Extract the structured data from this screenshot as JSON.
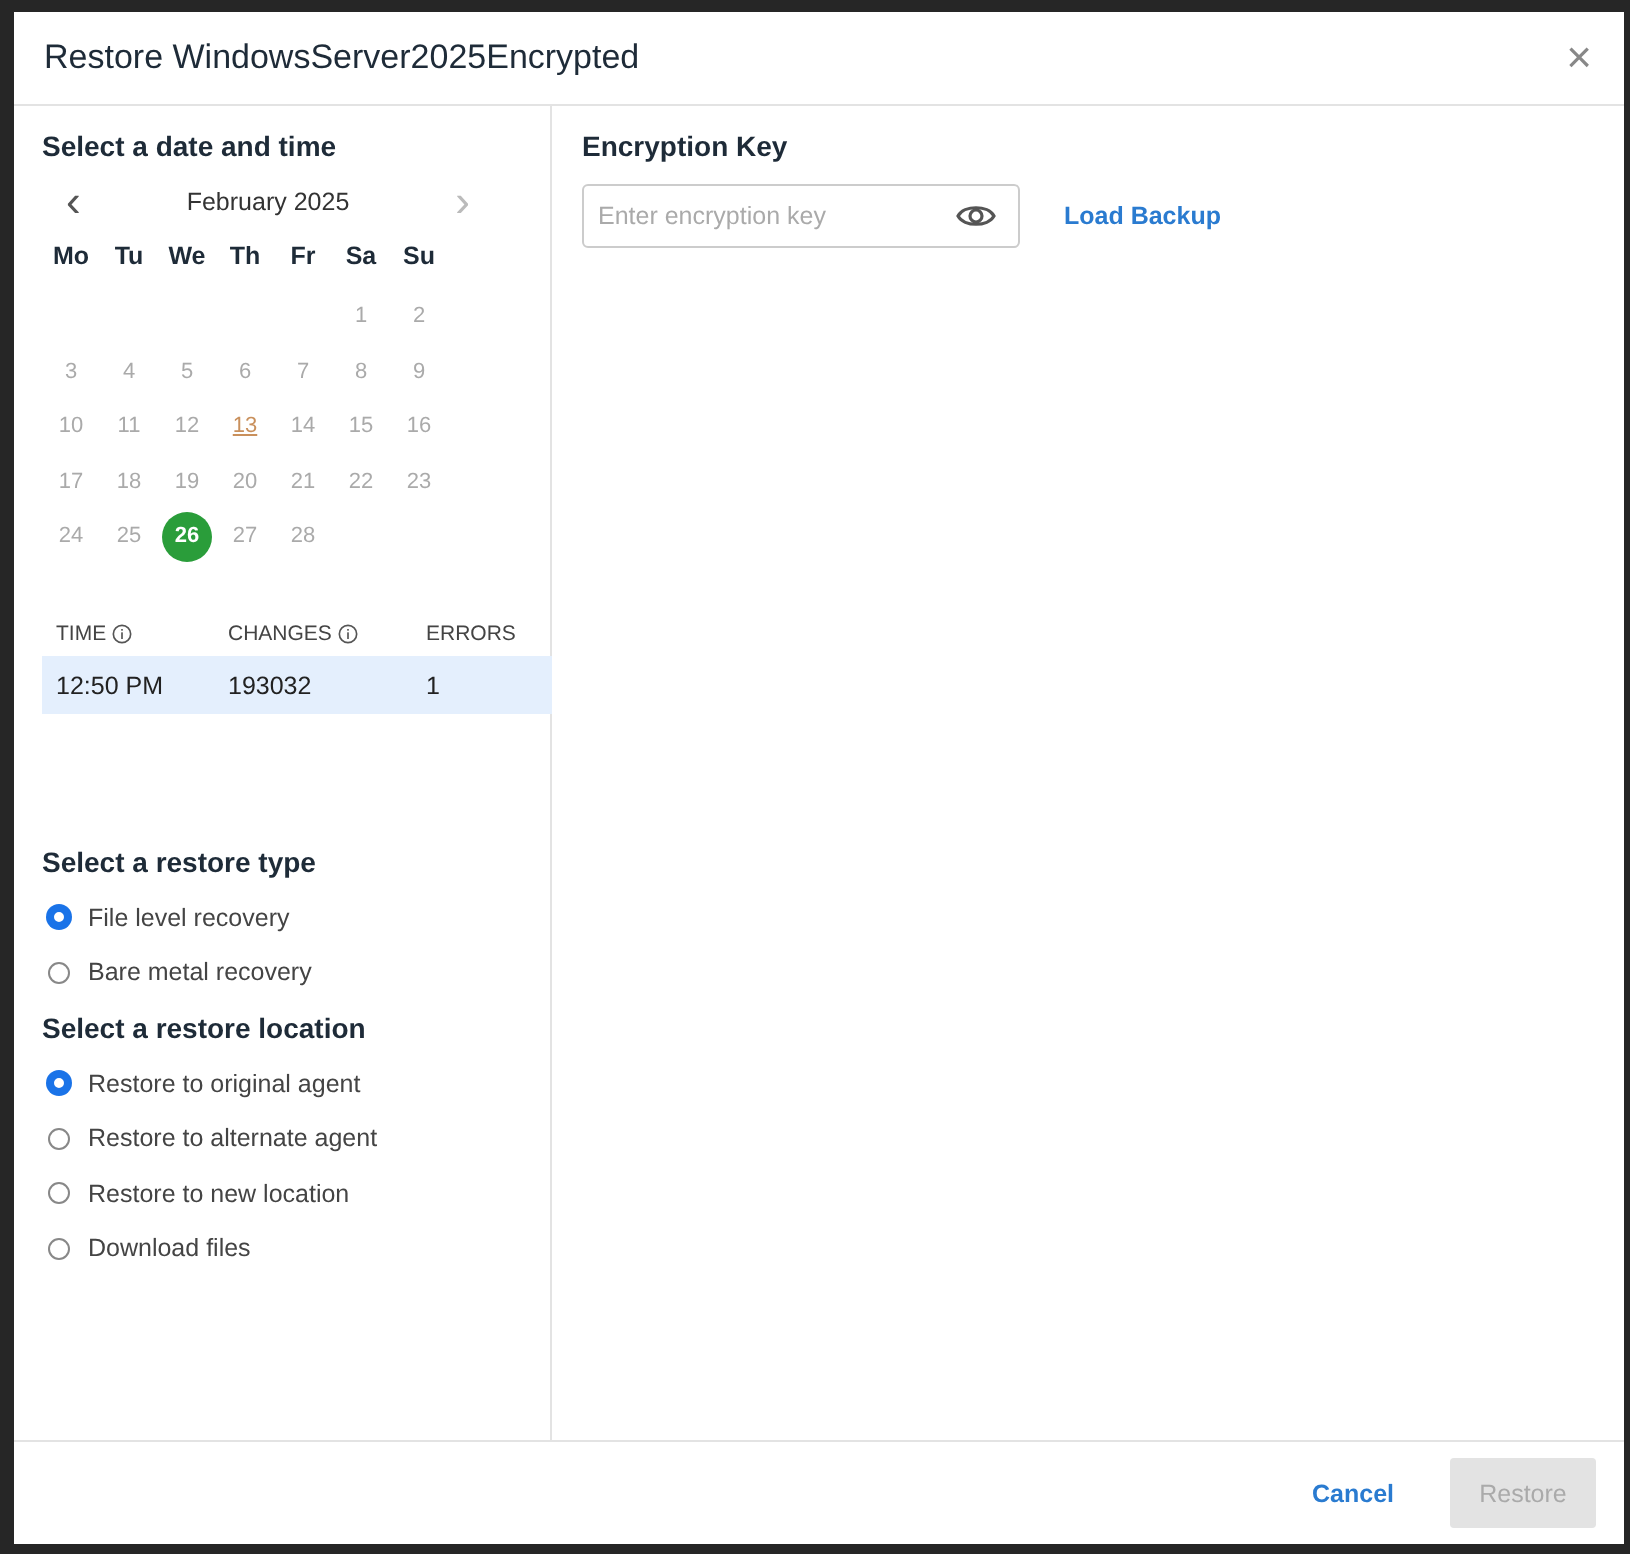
{
  "dialog": {
    "title": "Restore WindowsServer2025Encrypted",
    "close": "×"
  },
  "date_section": {
    "heading": "Select a date and time",
    "calendar": {
      "prev": "‹",
      "month": "February 2025",
      "next": "›",
      "weekdays": [
        "Mo",
        "Tu",
        "We",
        "Th",
        "Fr",
        "Sa",
        "Su"
      ],
      "weeks": [
        [
          {
            "day": "1",
            "selected": false,
            "today": false
          },
          {
            "day": "2",
            "selected": false,
            "today": false
          }
        ],
        [
          {
            "day": "3",
            "selected": false,
            "today": false
          },
          {
            "day": "4",
            "selected": false,
            "today": false
          },
          {
            "day": "5",
            "selected": false,
            "today": false
          },
          {
            "day": "6",
            "selected": false,
            "today": false
          },
          {
            "day": "7",
            "selected": false,
            "today": false
          },
          {
            "day": "8",
            "selected": false,
            "today": false
          },
          {
            "day": "9",
            "selected": false,
            "today": false
          }
        ],
        [
          {
            "day": "10",
            "selected": false,
            "today": false
          },
          {
            "day": "11",
            "selected": false,
            "today": false
          },
          {
            "day": "12",
            "selected": false,
            "today": false
          },
          {
            "day": "13",
            "selected": false,
            "today": true
          },
          {
            "day": "14",
            "selected": false,
            "today": false
          },
          {
            "day": "15",
            "selected": false,
            "today": false
          },
          {
            "day": "16",
            "selected": false,
            "today": false
          }
        ],
        [
          {
            "day": "17",
            "selected": false,
            "today": false
          },
          {
            "day": "18",
            "selected": false,
            "today": false
          },
          {
            "day": "19",
            "selected": false,
            "today": false
          },
          {
            "day": "20",
            "selected": false,
            "today": false
          },
          {
            "day": "21",
            "selected": false,
            "today": false
          },
          {
            "day": "22",
            "selected": false,
            "today": false
          },
          {
            "day": "23",
            "selected": false,
            "today": false
          }
        ],
        [
          {
            "day": "24",
            "selected": false,
            "today": false
          },
          {
            "day": "25",
            "selected": false,
            "today": false
          },
          {
            "day": "26",
            "selected": true,
            "today": false
          },
          {
            "day": "27",
            "selected": false,
            "today": false
          },
          {
            "day": "28",
            "selected": false,
            "today": false
          }
        ]
      ]
    },
    "table": {
      "columns": [
        {
          "label": "TIME",
          "info": true
        },
        {
          "label": "CHANGES",
          "info": true
        },
        {
          "label": "ERRORS",
          "info": false
        }
      ],
      "rows": [
        {
          "cells": [
            "12:50 PM",
            "193032",
            "1"
          ],
          "selected": true
        }
      ]
    }
  },
  "restore_type": {
    "heading": "Select a restore type",
    "options": [
      {
        "label": "File level recovery",
        "selected": true
      },
      {
        "label": "Bare metal recovery",
        "selected": false
      }
    ]
  },
  "restore_location": {
    "heading": "Select a restore location",
    "options": [
      {
        "label": "Restore to original agent",
        "selected": true
      },
      {
        "label": "Restore to alternate agent",
        "selected": false
      },
      {
        "label": "Restore to new location",
        "selected": false
      },
      {
        "label": "Download files",
        "selected": false
      }
    ]
  },
  "encryption": {
    "heading": "Encryption Key",
    "placeholder": "Enter encryption key",
    "load_link": "Load Backup"
  },
  "footer": {
    "cancel": "Cancel",
    "restore": {
      "label": "Restore",
      "disabled": true
    }
  }
}
